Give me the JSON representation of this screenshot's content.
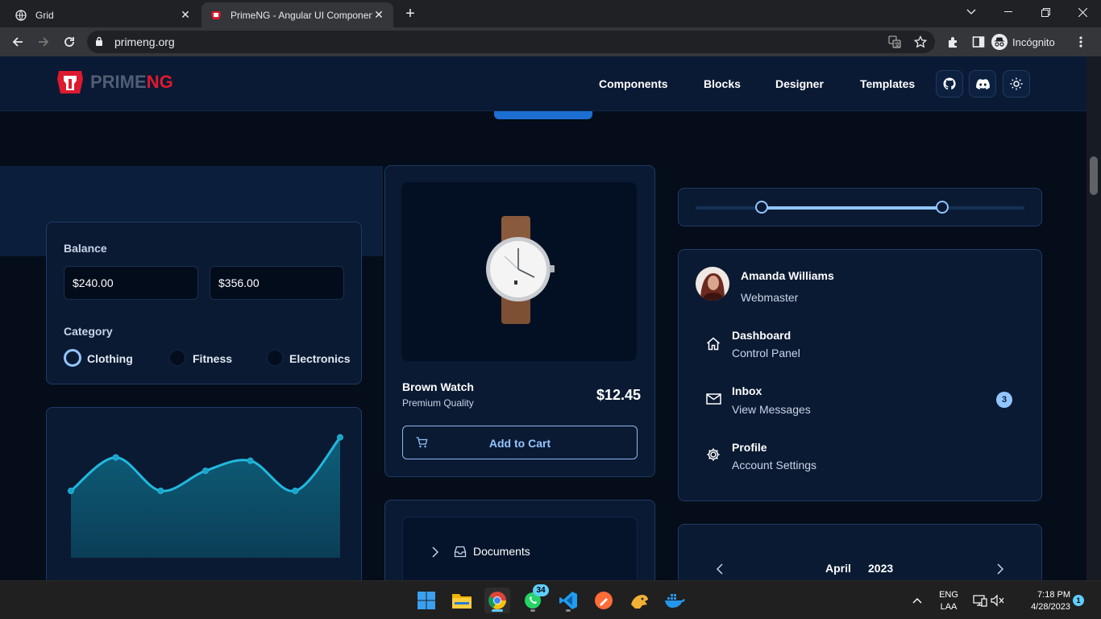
{
  "browser": {
    "tabs": [
      {
        "title": "Grid",
        "active": false
      },
      {
        "title": "PrimeNG - Angular UI Component Library",
        "active": true
      }
    ],
    "url": "primeng.org",
    "profile_label": "Incógnito"
  },
  "site": {
    "logo_part1": "PRIME",
    "logo_part2": "NG",
    "nav": [
      "Components",
      "Blocks",
      "Designer",
      "Templates"
    ],
    "nav_icons": [
      "github-icon",
      "discord-icon",
      "sun-icon"
    ]
  },
  "balance_card": {
    "label": "Balance",
    "min_value": "$240.00",
    "max_value": "$356.00",
    "category_label": "Category",
    "categories": [
      {
        "label": "Clothing",
        "selected": true
      },
      {
        "label": "Fitness",
        "selected": false
      },
      {
        "label": "Electronics",
        "selected": false
      }
    ]
  },
  "product_card": {
    "name": "Brown Watch",
    "subtitle": "Premium Quality",
    "price": "$12.45",
    "button": "Add to Cart"
  },
  "slider": {
    "range": [
      20,
      75
    ]
  },
  "profile_menu": {
    "user_name": "Amanda Williams",
    "user_role": "Webmaster",
    "items": [
      {
        "title": "Dashboard",
        "subtitle": "Control Panel",
        "icon": "home-icon"
      },
      {
        "title": "Inbox",
        "subtitle": "View Messages",
        "icon": "mail-icon",
        "badge": "3"
      },
      {
        "title": "Profile",
        "subtitle": "Account Settings",
        "icon": "cog-icon"
      }
    ]
  },
  "tree": {
    "item": "Documents"
  },
  "calendar": {
    "month": "April",
    "year": "2023"
  },
  "chart_data": {
    "type": "area",
    "x": [
      1,
      2,
      3,
      4,
      5,
      6,
      7
    ],
    "series": [
      {
        "values": [
          30,
          40,
          30,
          36,
          39,
          30,
          46
        ]
      }
    ],
    "ylim": [
      10,
      50
    ]
  },
  "taskbar": {
    "whatsapp_badge": "34",
    "lang": "ENG",
    "layout": "LAA",
    "time": "7:18 PM",
    "date": "4/28/2023",
    "notifications": "1"
  }
}
